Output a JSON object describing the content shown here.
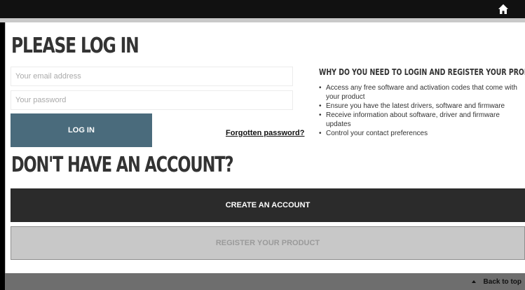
{
  "header": {
    "home_icon": "home-icon"
  },
  "login": {
    "title": "PLEASE LOG IN",
    "email_placeholder": "Your email address",
    "password_placeholder": "Your password",
    "login_label": "LOG IN",
    "forgot_label": "Forgotten password?"
  },
  "account": {
    "title": "DON'T HAVE AN ACCOUNT?",
    "create_label": "CREATE AN ACCOUNT",
    "register_label": "REGISTER YOUR PRODUCT"
  },
  "why": {
    "title": "WHY DO YOU NEED TO LOGIN AND REGISTER YOUR PRODUCT?",
    "items": [
      "Access any free software and activation codes that come with your product",
      "Ensure you have the latest drivers, software and firmware",
      "Receive information about software, driver and firmware updates",
      "Control your contact preferences"
    ]
  },
  "footer": {
    "back_to_top": "Back to top",
    "icon": "caret-up-icon"
  },
  "colors": {
    "login_button": "#4a6b7c",
    "create_button": "#2b2b2b",
    "register_button": "#c8c8c8",
    "footer": "#6e6e6e"
  }
}
